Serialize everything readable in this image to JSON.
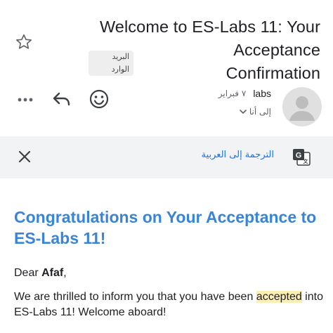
{
  "header": {
    "subject_line1": "Welcome to ES-Labs 11: Your",
    "subject_line2": "Acceptance Confirmation",
    "inbox_label": "البريد الوارد"
  },
  "sender": {
    "name": "labs",
    "date": "٧ فبراير",
    "to_label": "إلى أنا"
  },
  "translate_bar": {
    "text": "الترجمة إلى العربية"
  },
  "email": {
    "headline": "Congratulations on Your Acceptance to ES-Labs 11!",
    "greeting_prefix": "Dear ",
    "greeting_name": "Afaf",
    "greeting_suffix": ",",
    "para_before": "We are thrilled to inform you that you have been ",
    "para_highlight": "accepted",
    "para_after": " into ES-Labs 11! Welcome aboard!"
  },
  "icons": {
    "star": "star-icon",
    "more": "more-icon",
    "reply": "reply-icon",
    "emoji": "emoji-icon",
    "close": "close-icon",
    "translate": "translate-icon",
    "chevron": "chevron-down-icon",
    "avatar": "avatar"
  },
  "colors": {
    "headline": "#3a84d8",
    "link": "#1a73e8",
    "highlight": "#fcefb4",
    "translate_bar_bg": "#f1f3f4"
  }
}
